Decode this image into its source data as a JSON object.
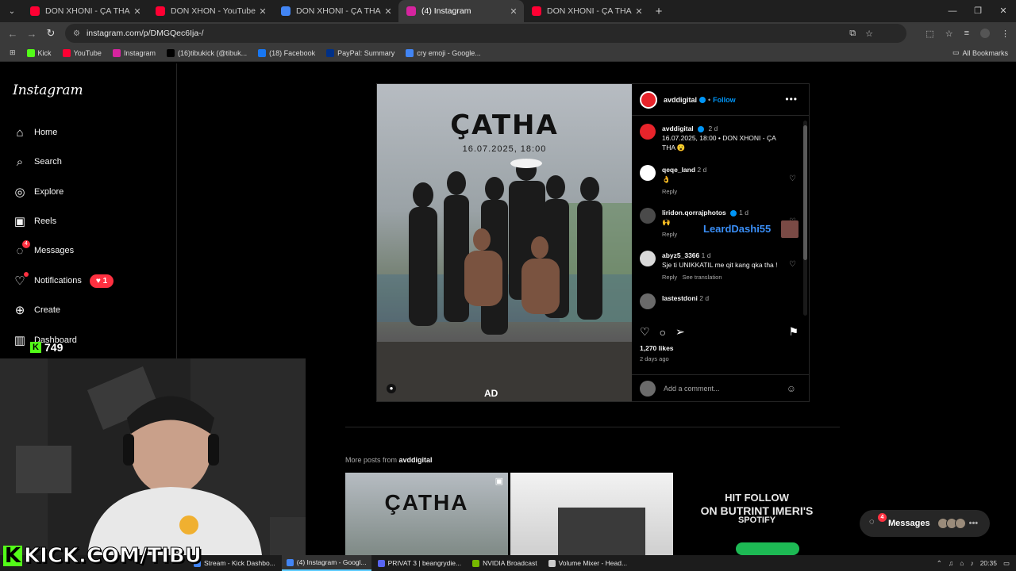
{
  "browser": {
    "tabs": [
      {
        "title": "DON XHONI - ÇA THA - YouTu",
        "color": "#ff0033",
        "active": false
      },
      {
        "title": "DON XHON - YouTube",
        "color": "#ff0033",
        "active": false
      },
      {
        "title": "DON XHONI - ÇA THA - Googl",
        "color": "#4285f4",
        "active": false
      },
      {
        "title": "(4) Instagram",
        "color": "#d6249f",
        "active": true
      },
      {
        "title": "DON XHONI - ÇA THA - YouTu",
        "color": "#ff0033",
        "active": false
      }
    ],
    "url": "instagram.com/p/DMGQec6Ija-/",
    "bookmarks": [
      {
        "label": "Kick",
        "color": "#53fc18"
      },
      {
        "label": "YouTube",
        "color": "#ff0033"
      },
      {
        "label": "Instagram",
        "color": "#d6249f"
      },
      {
        "label": "(16)tibukick (@tibuk...",
        "color": "#000000"
      },
      {
        "label": "(18) Facebook",
        "color": "#1877f2"
      },
      {
        "label": "PayPal: Summary",
        "color": "#003087"
      },
      {
        "label": "cry emoji - Google...",
        "color": "#4285f4"
      }
    ],
    "all_bookmarks": "All Bookmarks"
  },
  "sidebar": {
    "logo": "Instagram",
    "items": [
      {
        "label": "Home",
        "icon": "home-icon",
        "glyph": "⌂"
      },
      {
        "label": "Search",
        "icon": "search-icon",
        "glyph": "⌕"
      },
      {
        "label": "Explore",
        "icon": "compass-icon",
        "glyph": "◎"
      },
      {
        "label": "Reels",
        "icon": "reels-icon",
        "glyph": "▣"
      },
      {
        "label": "Messages",
        "icon": "messenger-icon",
        "glyph": "◌"
      },
      {
        "label": "Notifications",
        "icon": "heart-icon",
        "glyph": "♡"
      },
      {
        "label": "Create",
        "icon": "plus-icon",
        "glyph": "⊕"
      },
      {
        "label": "Dashboard",
        "icon": "dashboard-icon",
        "glyph": "▥"
      }
    ],
    "messages_badge": "4",
    "notifications_badge": "1",
    "kick_viewers": "749"
  },
  "post": {
    "image_title": "ÇATHA",
    "image_date": "16.07.2025, 18:00",
    "image_mark": "AD",
    "author": "avddigital",
    "follow": "Follow",
    "separator": "•",
    "caption": {
      "user": "avddigital",
      "time": "2 d",
      "text": "16.07.2025, 18:00 • DON XHONI - ÇA THA 😮"
    },
    "comments": [
      {
        "user": "qeqe_land",
        "time": "2 d",
        "text": "👌",
        "reply": "Reply",
        "translate": ""
      },
      {
        "user": "liridon.qorrajphotos",
        "time": "1 d",
        "text": "🙌",
        "reply": "Reply",
        "translate": "",
        "verified": true
      },
      {
        "user": "abyz5_3366",
        "time": "1 d",
        "text": "Sje ti UNIKKATIL me qit kang qka tha !",
        "reply": "Reply",
        "translate": "See translation"
      },
      {
        "user": "lastestdoni",
        "time": "2 d",
        "text": "",
        "reply": "",
        "translate": ""
      }
    ],
    "overlay_name": "LeardDashi55",
    "likes": "1,270 likes",
    "ago": "2 days ago",
    "add_comment_placeholder": "Add a comment..."
  },
  "more_posts": {
    "prefix": "More posts from",
    "author": "avddigital",
    "thumb1_title": "ÇATHA",
    "thumb3_line1": "HIT FOLLOW",
    "thumb3_line2": "ON BUTRINT IMERI'S",
    "thumb3_line3": "SPOTIFY"
  },
  "messages_pill": {
    "label": "Messages",
    "badge": "4"
  },
  "kick_overlay": "KICK.COM/TIBU",
  "taskbar": {
    "items": [
      {
        "label": "Stream - Kick Dashbo...",
        "color": "#4285f4",
        "active": false
      },
      {
        "label": "(4) Instagram - Googl...",
        "color": "#4285f4",
        "active": true
      },
      {
        "label": "PRIVAT 3 | beangrydie...",
        "color": "#5865f2",
        "active": false
      },
      {
        "label": "NVIDIA Broadcast",
        "color": "#76b900",
        "active": false
      },
      {
        "label": "Volume Mixer - Head...",
        "color": "#cccccc",
        "active": false
      }
    ],
    "time": "20:35"
  }
}
